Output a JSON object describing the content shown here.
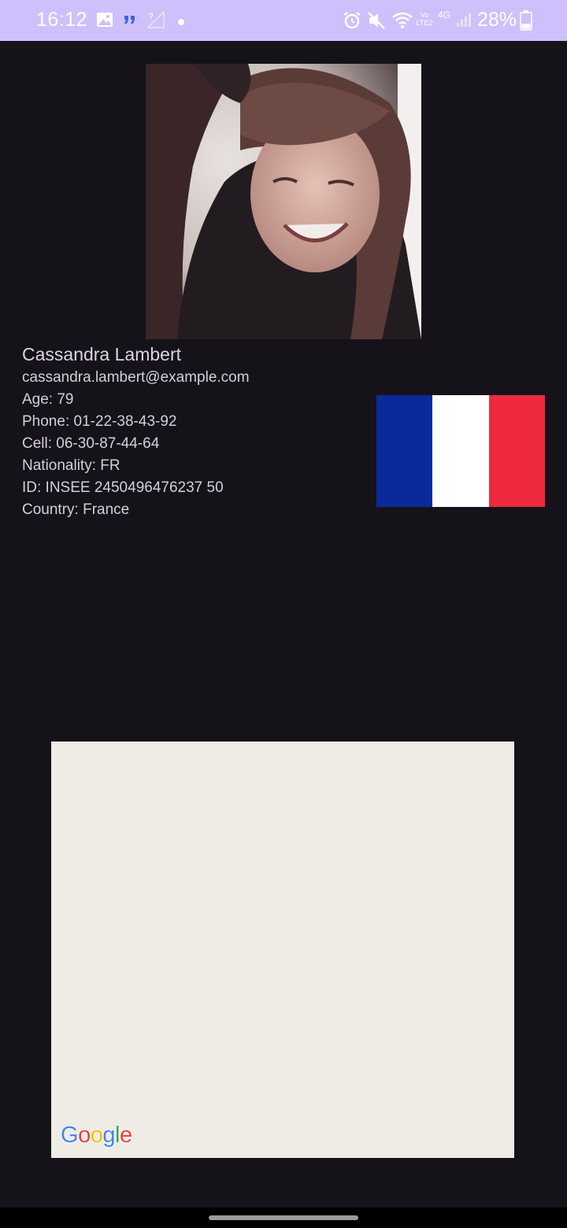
{
  "status_bar": {
    "time": "16:12",
    "battery": "28%",
    "colors": {
      "background": "#cfc0fb",
      "foreground": "#ffffff"
    },
    "left_icons": [
      "gallery-icon",
      "quote-icon",
      "no-signal-icon",
      "notification-dot-icon"
    ],
    "right_icons": [
      "alarm-icon",
      "mute-icon",
      "wifi-icon",
      "volte-icon",
      "4g-icon",
      "cell-signal-icon",
      "battery-icon"
    ],
    "volte_label": "Vo LTE2",
    "network_label": "4G"
  },
  "profile": {
    "name": "Cassandra Lambert",
    "email": "cassandra.lambert@example.com",
    "age": "Age: 79",
    "phone": "Phone: 01-22-38-43-92",
    "cell": "Cell: 06-30-87-44-64",
    "nationality": "Nationality: FR",
    "id": "ID: INSEE 2450496476237 50",
    "country": "Country: France"
  },
  "flag": {
    "country": "France",
    "colors": [
      "#0a2a9b",
      "#ffffff",
      "#ee2a3c"
    ]
  },
  "map": {
    "background": "#efebe5",
    "attribution": {
      "letters": [
        "G",
        "o",
        "o",
        "g",
        "l",
        "e"
      ],
      "colors": [
        "#4285f4",
        "#ea4335",
        "#fbbc05",
        "#4285f4",
        "#34a853",
        "#ea4335"
      ]
    }
  }
}
